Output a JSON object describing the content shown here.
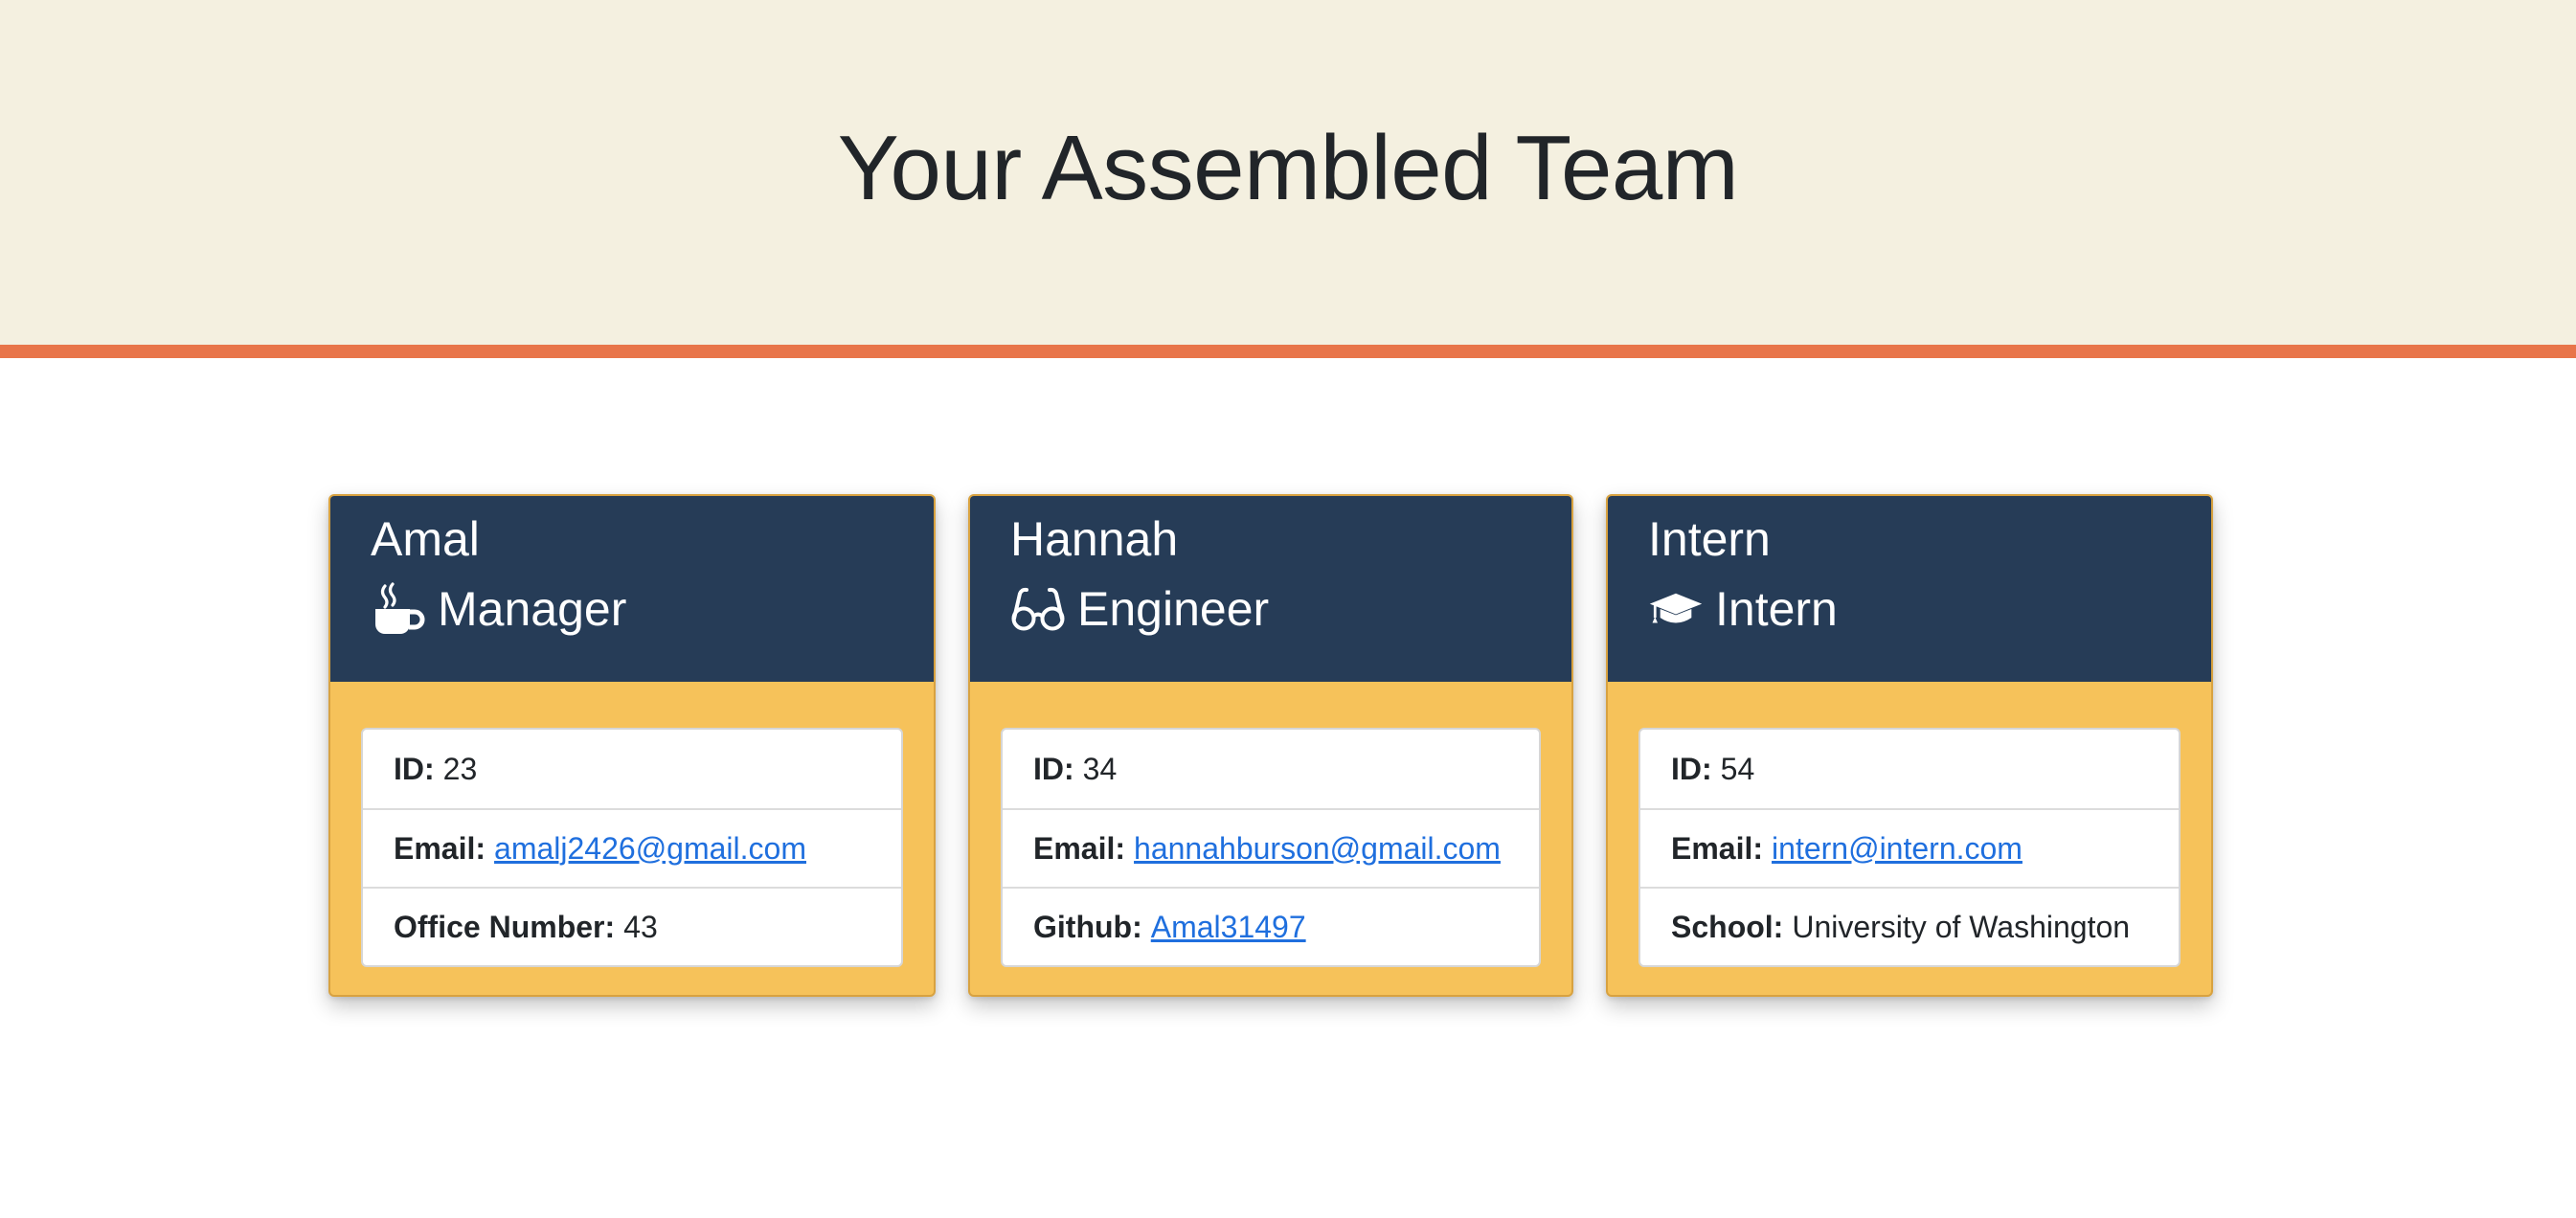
{
  "page": {
    "title": "Your Assembled Team"
  },
  "colors": {
    "header_bg": "#f4f0e0",
    "header_border": "#e8754a",
    "card_header_bg": "#263c57",
    "card_body_bg": "#f6c25a",
    "link": "#1f6fde"
  },
  "team": [
    {
      "name": "Amal",
      "role": "Manager",
      "icon": "mug-hot-icon",
      "id_label": "ID:",
      "id": "23",
      "email_label": "Email:",
      "email": "amalj2426@gmail.com",
      "extra_label": "Office Number:",
      "extra_value": "43"
    },
    {
      "name": "Hannah",
      "role": "Engineer",
      "icon": "glasses-icon",
      "id_label": "ID:",
      "id": "34",
      "email_label": "Email:",
      "email": "hannahburson@gmail.com",
      "extra_label": "Github:",
      "extra_value": "Amal31497"
    },
    {
      "name": "Intern",
      "role": "Intern",
      "icon": "graduation-cap-icon",
      "id_label": "ID:",
      "id": "54",
      "email_label": "Email:",
      "email": "intern@intern.com",
      "extra_label": "School:",
      "extra_value": "University of Washington"
    }
  ]
}
